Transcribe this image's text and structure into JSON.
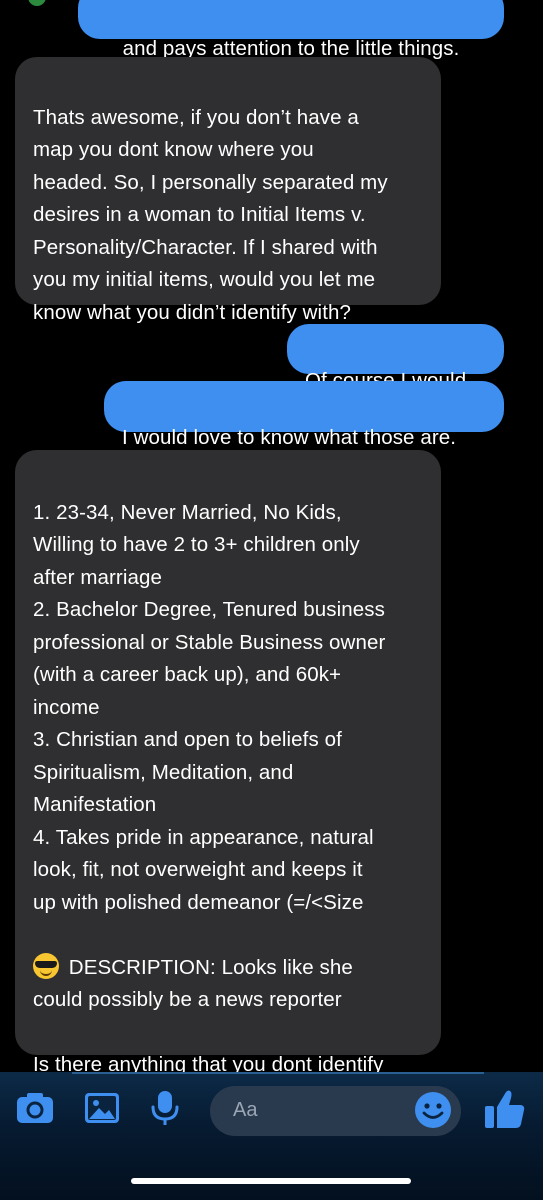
{
  "messages": {
    "top_partial": "and pays attention to the little things.",
    "incoming_1": "Thats awesome, if you don’t have a\nmap you dont know where you\nheaded. So, I personally separated my\ndesires in a woman to Initial Items v.\nPersonality/Character. If I shared with\nyou my initial items, would you let me\nknow what you didn’t identify with?",
    "outgoing_1": "Of course I would.",
    "outgoing_2": "I would love to know what those are.",
    "incoming_2_part1": "1. 23-34, Never Married, No Kids,\nWilling to have 2 to 3+ children only\nafter marriage\n2. Bachelor Degree, Tenured business\nprofessional or Stable Business owner\n(with a career back up),  and 60k+\nincome\n3. Christian and open to beliefs of\nSpiritualism, Meditation, and\nManifestation\n4. Takes pride in appearance, natural\nlook, fit, not overweight and keeps it\nup with polished demeanor (=/<Size",
    "incoming_2_emoji": "sunglasses-face-emoji",
    "incoming_2_part2": " DESCRIPTION: Looks like she\ncould possibly be a news reporter\n\nIs there anything that you dont identify\nwith on the list?"
  },
  "composer": {
    "placeholder": "Aa",
    "icons": [
      "camera-icon",
      "gallery-icon",
      "microphone-icon",
      "emoji-icon",
      "thumbs-up-icon"
    ]
  },
  "colors": {
    "outgoing_bubble": "#3e8ff0",
    "incoming_bubble": "#2f2f31",
    "icon_blue": "#3e8ff0"
  }
}
